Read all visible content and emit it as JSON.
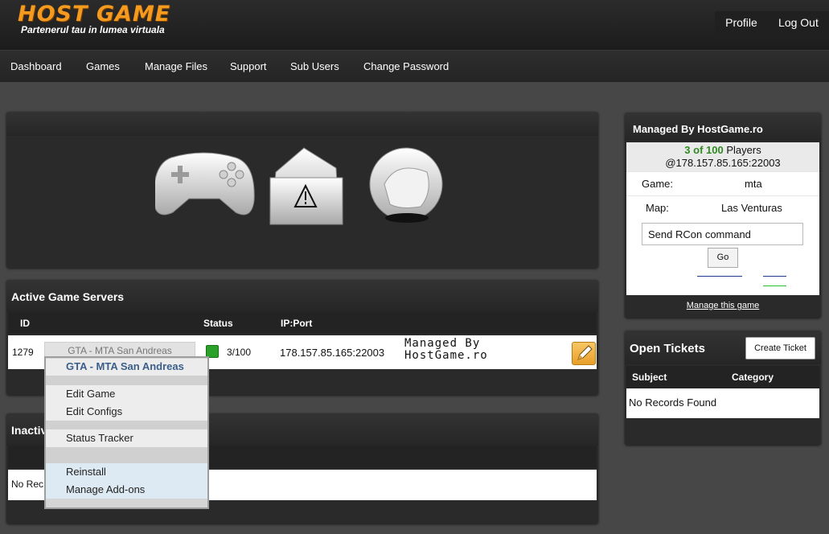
{
  "header": {
    "logo_text": "HOST GAME",
    "logo_tagline": "Partenerul tau in lumea virtuala",
    "profile_label": "Profile",
    "logout_label": "Log Out"
  },
  "nav": {
    "items": [
      "Dashboard",
      "Games",
      "Manage Files",
      "Support",
      "Sub Users",
      "Change Password"
    ]
  },
  "active_servers": {
    "title": "Active Game Servers",
    "columns": {
      "id": "ID",
      "status": "Status",
      "ipport": "IP:Port"
    },
    "row": {
      "id": "1279",
      "game": "GTA - MTA San Andreas",
      "players": "3/100",
      "ipport": "178.157.85.165:22003",
      "managed": "Managed By\nHostGame.ro",
      "status_color": "#2aa22a"
    }
  },
  "context_menu": {
    "title": "GTA - MTA San Andreas",
    "items": [
      "Edit Game",
      "Edit Configs",
      "Status Tracker",
      "Reinstall",
      "Manage Add-ons"
    ]
  },
  "inactive_servers": {
    "title_visible": "Inactiv",
    "no_records_visible": "No Rec"
  },
  "managed_panel": {
    "title": "Managed By HostGame.ro",
    "players_count": "3 of 100",
    "players_word": "Players",
    "address": "@178.157.85.165:22003",
    "game_label": "Game:",
    "game_value": "mta",
    "map_label": "Map:",
    "map_value": "Las Venturas",
    "rcon_value": "Send RCon command",
    "go_label": "Go",
    "manage_link": "Manage this game"
  },
  "tickets": {
    "title": "Open Tickets",
    "create_label": "Create Ticket",
    "col_subject": "Subject",
    "col_category": "Category",
    "empty": "No Records Found"
  },
  "colors": {
    "accent": "#f49a1f",
    "players_green": "#2e8b1f",
    "menu_title": "#3b5f8a"
  }
}
